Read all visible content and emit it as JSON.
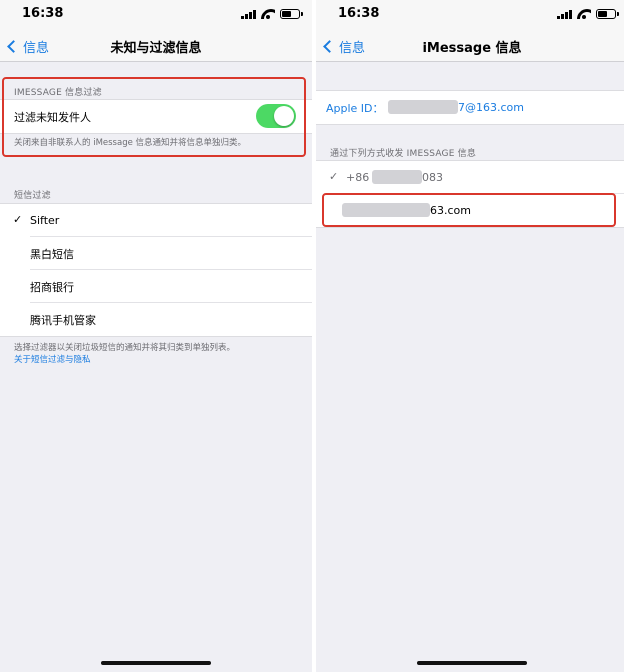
{
  "left": {
    "status": {
      "time": "16:38"
    },
    "nav": {
      "back_label": "信息",
      "title": "未知与过滤信息"
    },
    "imessage_section": {
      "header": "IMESSAGE 信息过滤",
      "toggle_label": "过滤未知发件人",
      "toggle_on": true,
      "footer": "关闭来自非联系人的 iMessage 信息通知并将信息单独归类。"
    },
    "sms_section": {
      "header": "短信过滤",
      "items": [
        {
          "label": "Sifter",
          "selected": true
        },
        {
          "label": "黑白短信",
          "selected": false
        },
        {
          "label": "招商银行",
          "selected": false
        },
        {
          "label": "腾讯手机管家",
          "selected": false
        }
      ],
      "footer": "选择过滤器以关闭垃圾短信的通知并将其归类到单独列表。",
      "footer_link": "关于短信过滤与隐私"
    }
  },
  "right": {
    "status": {
      "time": "16:38"
    },
    "nav": {
      "back_label": "信息",
      "title": "iMessage 信息"
    },
    "apple_id": {
      "label": "Apple ID：",
      "value_suffix": "7@163.com"
    },
    "send_receive": {
      "header": "通过下列方式收发 IMESSAGE 信息",
      "phone": {
        "prefix": "+86",
        "suffix": "083",
        "checked": true
      },
      "email": {
        "suffix": "63.com",
        "checked": false
      }
    }
  },
  "colors": {
    "accent": "#1a7ce0",
    "toggle_on": "#4cd964",
    "highlight": "#d9372c"
  }
}
